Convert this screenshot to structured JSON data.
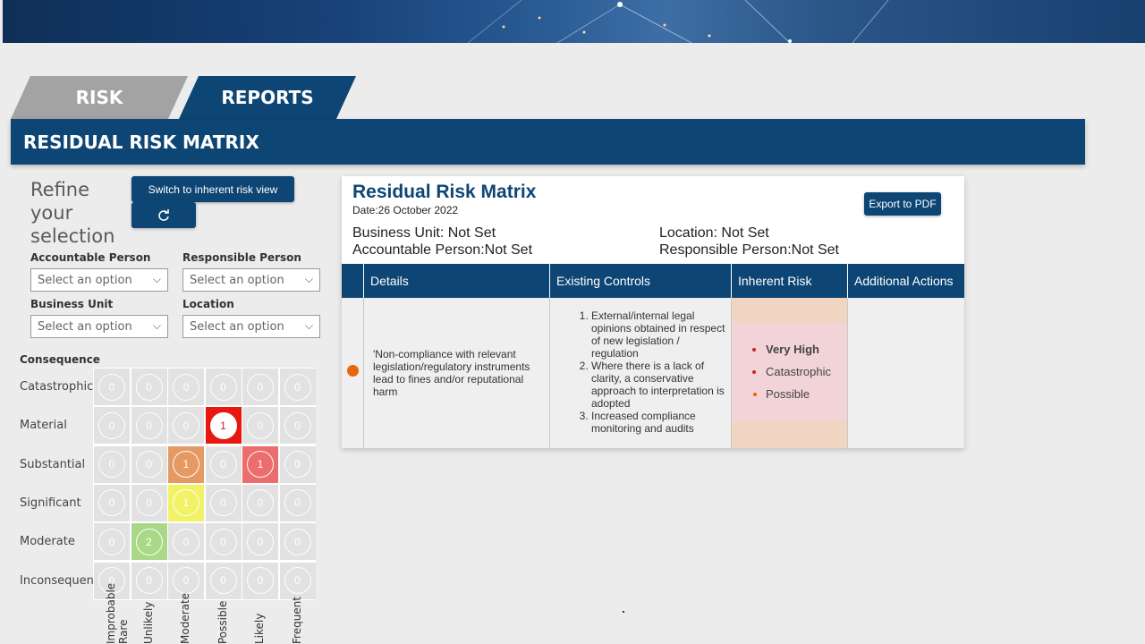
{
  "tabs": {
    "risk": "RISK",
    "reports": "REPORTS"
  },
  "title_bar": "RESIDUAL RISK MATRIX",
  "filters": {
    "heading": "Refine your selection",
    "switch_button": "Switch to inherent risk view",
    "refresh_icon": "refresh-icon",
    "accountable_label": "Accountable Person",
    "responsible_label": "Responsible Person",
    "business_unit_label": "Business Unit",
    "location_label": "Location",
    "placeholder": "Select an option"
  },
  "matrix": {
    "consequence_title": "Consequence",
    "rows": [
      "Catastrophic",
      "Material",
      "Substantial",
      "Significant",
      "Moderate",
      "Inconsequential"
    ],
    "columns": [
      "Improbable Rare",
      "Unlikely",
      "Moderate",
      "Possible",
      "Likely",
      "Frequent"
    ],
    "values": [
      [
        0,
        0,
        0,
        0,
        0,
        0
      ],
      [
        0,
        0,
        0,
        1,
        0,
        0
      ],
      [
        0,
        0,
        1,
        0,
        1,
        0
      ],
      [
        0,
        0,
        1,
        0,
        0,
        0
      ],
      [
        0,
        2,
        0,
        0,
        0,
        0
      ],
      [
        0,
        0,
        0,
        0,
        0,
        0
      ]
    ],
    "colors": [
      [
        "",
        "",
        "",
        "",
        "",
        ""
      ],
      [
        "",
        "",
        "",
        "#e8170f",
        "",
        ""
      ],
      [
        "",
        "",
        "#e59a64",
        "",
        "#ec6d6d",
        ""
      ],
      [
        "",
        "",
        "#f2f266",
        "",
        "",
        ""
      ],
      [
        "",
        "#a9d988",
        "",
        "",
        "",
        ""
      ],
      [
        "",
        "",
        "",
        "",
        "",
        ""
      ]
    ]
  },
  "report": {
    "title": "Residual Risk Matrix",
    "date": "Date:26 October 2022",
    "export_button": "Export to PDF",
    "business_unit": "Business Unit: Not Set",
    "location": "Location: Not Set",
    "accountable_person": "Accountable Person:Not Set",
    "responsible_person": "Responsible Person:Not Set",
    "headers": [
      "Details",
      "Existing Controls",
      "Inherent Risk",
      "Additional Actions"
    ],
    "row": {
      "details": "'Non-compliance with relevant legislation/regulatory instruments lead to fines and/or reputational harm",
      "controls": [
        "External/internal legal opinions obtained in respect of new legislation / regulation",
        "Where there is a lack of clarity, a conservative approach to interpretation is adopted",
        "Increased compliance monitoring and audits"
      ],
      "inherent_risk": {
        "level": "Very High",
        "consequence": "Catastrophic",
        "likelihood": "Possible"
      },
      "additional_actions": ""
    }
  },
  "colors": {
    "primary": "#0d4574",
    "tab_inactive": "#a3a3a3",
    "status_dot": "#e8660f"
  }
}
